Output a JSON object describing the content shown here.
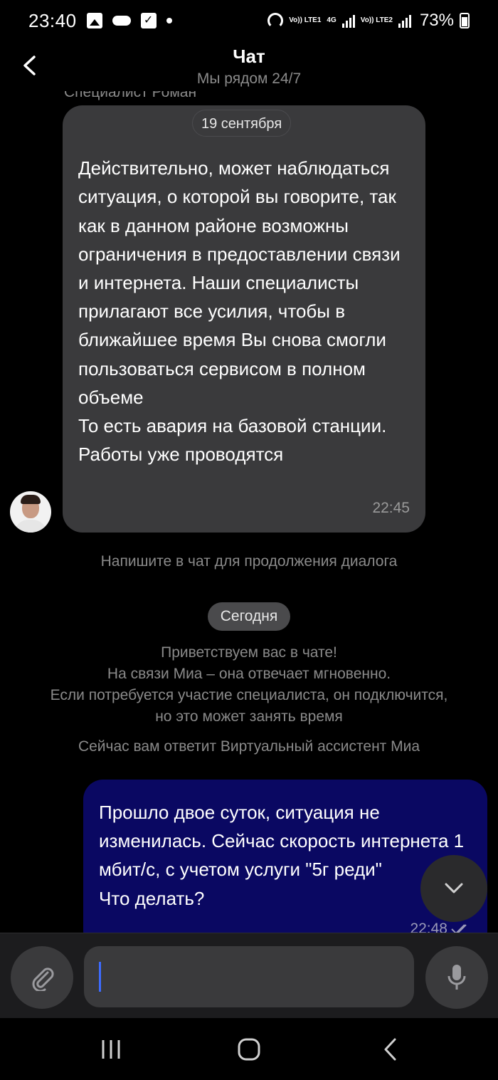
{
  "status_bar": {
    "time": "23:40",
    "battery": "73%",
    "net1": "Vo)) LTE1",
    "net_type": "4G",
    "net2": "Vo)) LTE2"
  },
  "header": {
    "title": "Чат",
    "subtitle": "Мы рядом 24/7"
  },
  "chat": {
    "sender_name": "Специалист Роман",
    "date_pill": "19 сентября",
    "incoming_message": {
      "text": "Действительно, может наблюдаться ситуация, о которой вы говорите, так как в данном районе возможны ограничения в предоставлении связи и интернета. Наши специалисты прилагают все усилия, чтобы в ближайшее время Вы снова смогли пользоваться сервисом в полном объеме\nТо есть авария на базовой станции. Работы уже проводятся",
      "time": "22:45"
    },
    "continue_hint": "Напишите в чат для продолжения диалога",
    "today_pill": "Сегодня",
    "welcome_lines": [
      "Приветствуем вас в чате!",
      "На связи Миа – она отвечает мгновенно.",
      "Если потребуется участие специалиста, он подключится,",
      "но это может занять время"
    ],
    "assistant_note": "Сейчас вам ответит Виртуальный ассистент Миа",
    "outgoing_message": {
      "text": "Прошло двое суток, ситуация не изменилась. Сейчас скорость интернета 1 мбит/с, с учетом услуги \"5г реди\"\nЧто делать?",
      "time": "22:48"
    }
  },
  "input": {
    "value": "",
    "placeholder": ""
  },
  "colors": {
    "incoming_bubble": "#3a3a3c",
    "outgoing_bubble": "#0a0862",
    "cursor": "#3d6bff"
  }
}
